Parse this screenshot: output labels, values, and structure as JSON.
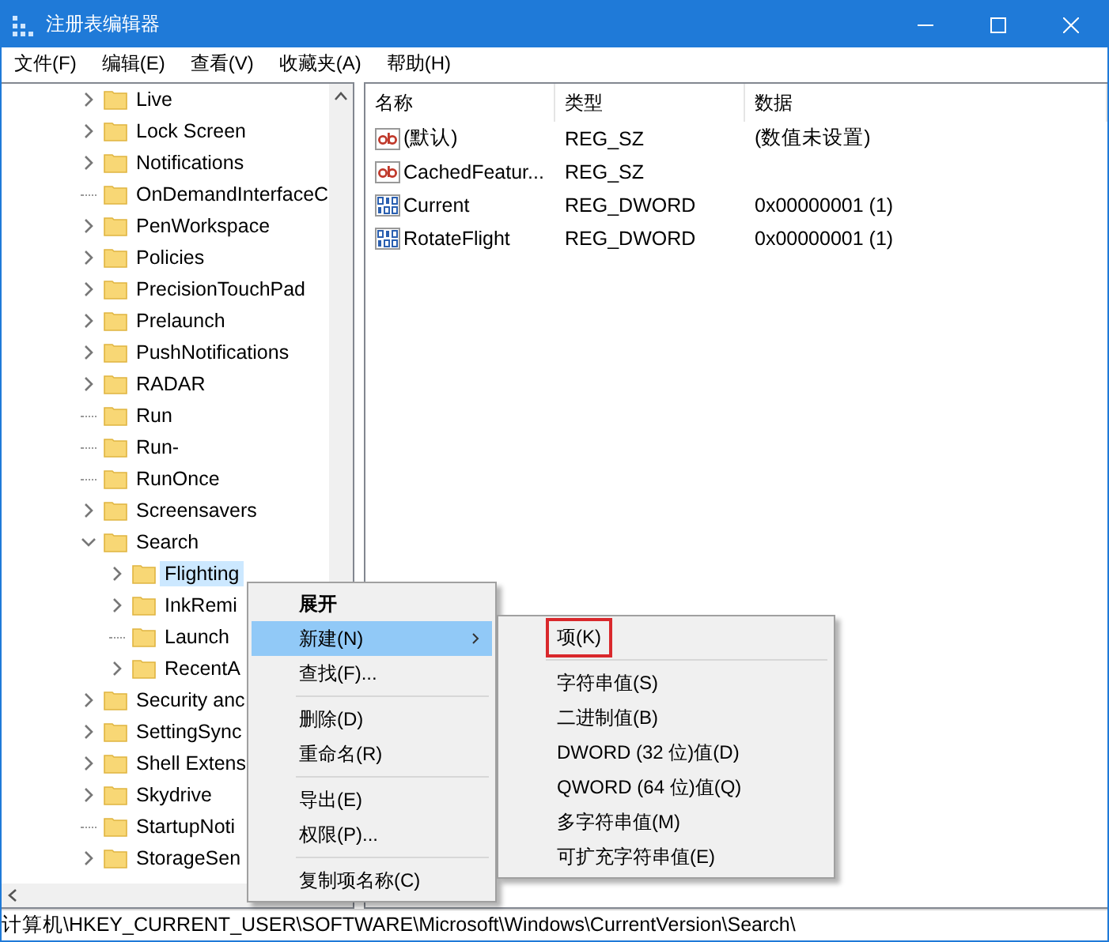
{
  "window": {
    "title": "注册表编辑器"
  },
  "menu_bar": [
    "文件(F)",
    "编辑(E)",
    "查看(V)",
    "收藏夹(A)",
    "帮助(H)"
  ],
  "tree": [
    {
      "label": "Live",
      "has_children": true,
      "expanded": false,
      "selected": false
    },
    {
      "label": "Lock Screen",
      "has_children": true,
      "expanded": false,
      "selected": false
    },
    {
      "label": "Notifications",
      "has_children": true,
      "expanded": false,
      "selected": false
    },
    {
      "label": "OnDemandInterfaceC",
      "has_children": false,
      "selected": false
    },
    {
      "label": "PenWorkspace",
      "has_children": true,
      "expanded": false,
      "selected": false
    },
    {
      "label": "Policies",
      "has_children": true,
      "expanded": false,
      "selected": false
    },
    {
      "label": "PrecisionTouchPad",
      "has_children": true,
      "expanded": false,
      "selected": false
    },
    {
      "label": "Prelaunch",
      "has_children": true,
      "expanded": false,
      "selected": false
    },
    {
      "label": "PushNotifications",
      "has_children": true,
      "expanded": false,
      "selected": false
    },
    {
      "label": "RADAR",
      "has_children": true,
      "expanded": false,
      "selected": false
    },
    {
      "label": "Run",
      "has_children": false,
      "selected": false
    },
    {
      "label": "Run-",
      "has_children": false,
      "selected": false
    },
    {
      "label": "RunOnce",
      "has_children": false,
      "selected": false
    },
    {
      "label": "Screensavers",
      "has_children": true,
      "expanded": false,
      "selected": false
    },
    {
      "label": "Search",
      "has_children": true,
      "expanded": true,
      "selected": false,
      "children": [
        {
          "label": "Flighting",
          "has_children": true,
          "expanded": false,
          "selected": true
        },
        {
          "label": "InkRemi",
          "has_children": true,
          "expanded": false,
          "selected": false
        },
        {
          "label": "Launch",
          "has_children": false,
          "selected": false
        },
        {
          "label": "RecentA",
          "has_children": true,
          "expanded": false,
          "selected": false
        }
      ]
    },
    {
      "label": "Security anc",
      "has_children": true,
      "expanded": false,
      "selected": false
    },
    {
      "label": "SettingSync",
      "has_children": true,
      "expanded": false,
      "selected": false
    },
    {
      "label": "Shell Extens",
      "has_children": true,
      "expanded": false,
      "selected": false
    },
    {
      "label": "Skydrive",
      "has_children": true,
      "expanded": false,
      "selected": false
    },
    {
      "label": "StartupNoti",
      "has_children": false,
      "selected": false
    },
    {
      "label": "StorageSen",
      "has_children": true,
      "expanded": false,
      "selected": false
    }
  ],
  "values_table": {
    "columns": [
      "名称",
      "类型",
      "数据"
    ],
    "rows": [
      {
        "kind": "string",
        "name": "(默认)",
        "type": "REG_SZ",
        "data": "(数值未设置)"
      },
      {
        "kind": "string",
        "name": "CachedFeatur...",
        "type": "REG_SZ"
      },
      {
        "kind": "binary",
        "name": "Current",
        "type": "REG_DWORD",
        "data": "0x00000001 (1)"
      },
      {
        "kind": "binary",
        "name": "RotateFlight",
        "type": "REG_DWORD",
        "data": "0x00000001 (1)"
      }
    ]
  },
  "context_menu": {
    "groups": [
      [
        {
          "label": "展开",
          "bold": true,
          "selected": false,
          "has_submenu": false
        },
        {
          "label": "新建(N)",
          "bold": false,
          "selected": true,
          "has_submenu": true
        },
        {
          "label": "查找(F)...",
          "bold": false,
          "selected": false,
          "has_submenu": false
        }
      ],
      [
        {
          "label": "删除(D)",
          "bold": false,
          "selected": false,
          "has_submenu": false
        },
        {
          "label": "重命名(R)",
          "bold": false,
          "selected": false,
          "has_submenu": false
        }
      ],
      [
        {
          "label": "导出(E)",
          "bold": false,
          "selected": false,
          "has_submenu": false
        },
        {
          "label": "权限(P)...",
          "bold": false,
          "selected": false,
          "has_submenu": false
        }
      ],
      [
        {
          "label": "复制项名称(C)",
          "bold": false,
          "selected": false,
          "has_submenu": false
        }
      ]
    ]
  },
  "submenu": {
    "groups": [
      [
        {
          "label": "项(K)",
          "outlined": true
        }
      ],
      [
        {
          "label": "字符串值(S)",
          "outlined": false
        },
        {
          "label": "二进制值(B)",
          "outlined": false
        },
        {
          "label": "DWORD (32 位)值(D)",
          "outlined": false
        },
        {
          "label": "QWORD (64 位)值(Q)",
          "outlined": false
        },
        {
          "label": "多字符串值(M)",
          "outlined": false
        },
        {
          "label": "可扩充字符串值(E)",
          "outlined": false
        }
      ]
    ]
  },
  "status_bar": "计算机\\HKEY_CURRENT_USER\\SOFTWARE\\Microsoft\\Windows\\CurrentVersion\\Search\\"
}
